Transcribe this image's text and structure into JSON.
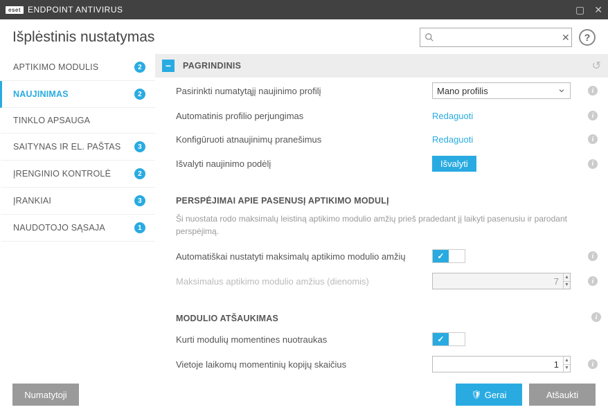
{
  "titlebar": {
    "brand": "eset",
    "title": "ENDPOINT ANTIVIRUS"
  },
  "header": {
    "title": "Išplėstinis nustatymas",
    "search_placeholder": ""
  },
  "sidebar": {
    "items": [
      {
        "label": "APTIKIMO MODULIS",
        "badge": "2",
        "active": false
      },
      {
        "label": "NAUJINIMAS",
        "badge": "2",
        "active": true
      },
      {
        "label": "TINKLO APSAUGA",
        "badge": "",
        "active": false
      },
      {
        "label": "SAITYNAS IR EL. PAŠTAS",
        "badge": "3",
        "active": false
      },
      {
        "label": "ĮRENGINIO KONTROLĖ",
        "badge": "2",
        "active": false
      },
      {
        "label": "ĮRANKIAI",
        "badge": "3",
        "active": false
      },
      {
        "label": "NAUDOTOJO SĄSAJA",
        "badge": "1",
        "active": false
      }
    ]
  },
  "sections": {
    "main": {
      "title": "PAGRINDINIS",
      "rows": {
        "select_profile": {
          "label": "Pasirinkti numatytąjį naujinimo profilį",
          "value": "Mano profilis"
        },
        "auto_switch": {
          "label": "Automatinis profilio perjungimas",
          "action": "Redaguoti"
        },
        "config_notif": {
          "label": "Konfigūruoti atnaujinimų pranešimus",
          "action": "Redaguoti"
        },
        "clear_cache": {
          "label": "Išvalyti naujinimo podėlį",
          "action": "Išvalyti"
        }
      }
    },
    "outdated": {
      "title": "PERSPĖJIMAI APIE PASENUSĮ APTIKIMO MODULĮ",
      "desc": "Ši nuostata rodo maksimalų leistiną aptikimo modulio amžių prieš pradedant jį laikyti pasenusiu ir parodant perspėjimą.",
      "rows": {
        "auto_age": {
          "label": "Automatiškai nustatyti maksimalų aptikimo modulio amžių",
          "on": true
        },
        "max_age": {
          "label": "Maksimalus aptikimo modulio amžius (dienomis)",
          "value": "7"
        }
      }
    },
    "rollback": {
      "title": "MODULIO ATŠAUKIMAS",
      "rows": {
        "snapshots": {
          "label": "Kurti modulių momentines nuotraukas",
          "on": true
        },
        "keep_count": {
          "label": "Vietoje laikomų momentinių kopijų skaičius",
          "value": "1"
        }
      }
    }
  },
  "footer": {
    "default": "Numatytoji",
    "ok": "Gerai",
    "cancel": "Atšaukti"
  }
}
